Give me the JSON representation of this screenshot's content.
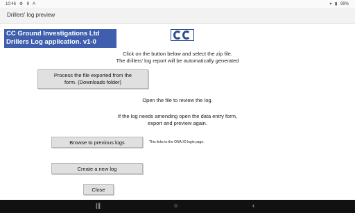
{
  "status_bar": {
    "time": "10:46",
    "left_icons": [
      "settings-icon",
      "download-icon",
      "text-icon"
    ],
    "battery": "99%"
  },
  "app_bar": {
    "title": "Drillers' log preview"
  },
  "header": {
    "line1": "CC Ground Investigations Ltd",
    "line2": "Drillers Log application. v1-0",
    "bg_color": "#3f5fae"
  },
  "logo": {
    "text": "CC"
  },
  "instructions": {
    "line1": "Click on the button below and select the zip file.",
    "line2": "The drillers' log report will be automatically generated",
    "line3": "Open the file to review the log.",
    "line4": "If the log needs amending open the data entry form,",
    "line5": "export and preview again."
  },
  "buttons": {
    "process_line1": "Process the file exported from the",
    "process_line2": "form. (Downloads folder)",
    "browse": "Browse to previous logs",
    "create": "Create a new log",
    "close": "Close"
  },
  "notes": {
    "browse_note": "This links to the ONA.IO login page."
  },
  "nav_bar": {
    "recent": "|||",
    "home": "○",
    "back": "‹"
  }
}
